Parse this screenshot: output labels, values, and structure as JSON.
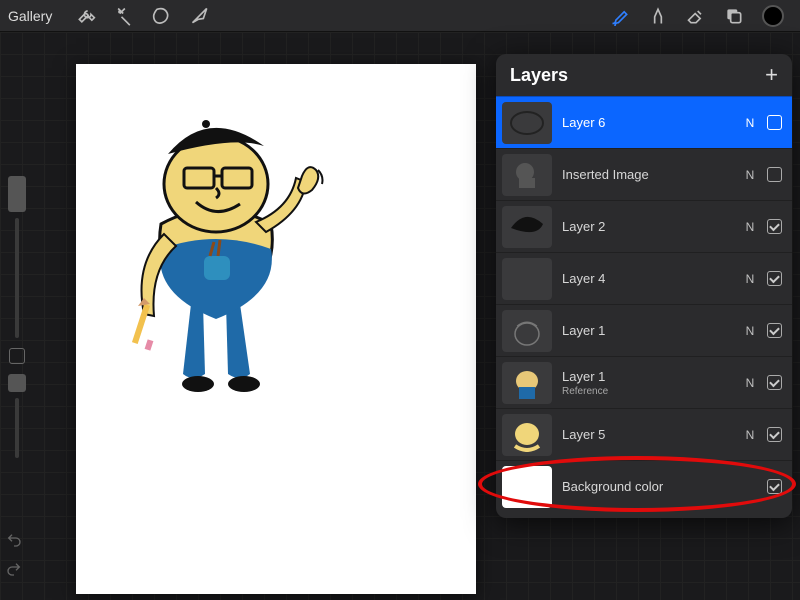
{
  "topbar": {
    "gallery_label": "Gallery"
  },
  "panel": {
    "title": "Layers",
    "layers": [
      {
        "name": "Layer 6",
        "blend": "N",
        "visible": false,
        "selected": true
      },
      {
        "name": "Inserted Image",
        "blend": "N",
        "visible": false,
        "selected": false
      },
      {
        "name": "Layer 2",
        "blend": "N",
        "visible": true,
        "selected": false
      },
      {
        "name": "Layer 4",
        "blend": "N",
        "visible": true,
        "selected": false
      },
      {
        "name": "Layer 1",
        "blend": "N",
        "visible": true,
        "selected": false
      },
      {
        "name": "Layer 1",
        "blend": "N",
        "visible": true,
        "selected": false,
        "sublabel": "Reference"
      },
      {
        "name": "Layer 5",
        "blend": "N",
        "visible": true,
        "selected": false
      }
    ],
    "background": {
      "name": "Background color",
      "visible": true
    }
  },
  "colors": {
    "accent": "#0b66ff",
    "annotation": "#e10b0b",
    "current_brush": "#000000"
  }
}
